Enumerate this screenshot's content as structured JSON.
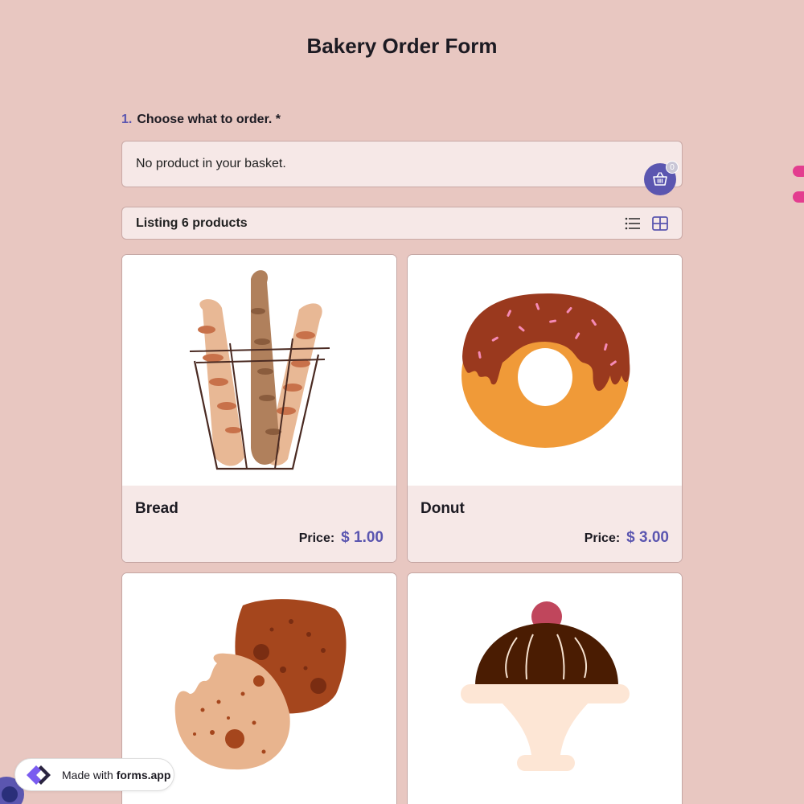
{
  "form": {
    "title": "Bakery Order Form"
  },
  "question": {
    "number": "1.",
    "text": "Choose what to order. *"
  },
  "basket": {
    "empty_text": "No product in your basket.",
    "count": "0",
    "icon": "basket-icon"
  },
  "listing": {
    "label": "Listing 6 products",
    "list_view_icon": "list-icon",
    "grid_view_icon": "grid-icon"
  },
  "products": [
    {
      "name": "Bread",
      "price_label": "Price:",
      "price": "$ 1.00"
    },
    {
      "name": "Donut",
      "price_label": "Price:",
      "price": "$ 3.00"
    },
    {
      "name": "",
      "price_label": "",
      "price": ""
    },
    {
      "name": "",
      "price_label": "",
      "price": ""
    }
  ],
  "footer_badge": {
    "prefix": "Made with",
    "brand": "forms.app"
  },
  "colors": {
    "background": "#e8c7c1",
    "accent": "#5b56b0",
    "panel": "#f6e8e7"
  }
}
